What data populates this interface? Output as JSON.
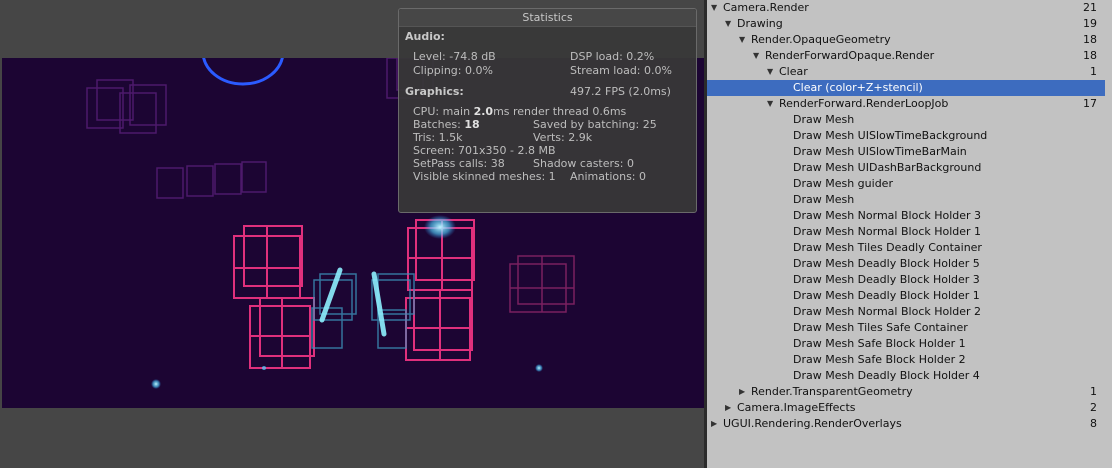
{
  "stats": {
    "title": "Statistics",
    "audio_header": "Audio:",
    "level": "Level: -74.8 dB",
    "dsp_load": "DSP load: 0.2%",
    "clipping": "Clipping: 0.0%",
    "stream_load": "Stream load: 0.0%",
    "graphics_header": "Graphics:",
    "fps": "497.2 FPS (2.0ms)",
    "cpu_prefix": "CPU: main ",
    "cpu_main": "2.0",
    "cpu_suffix": "ms  render thread 0.6ms",
    "batches_prefix": "Batches: ",
    "batches": "18",
    "saved_batching": "Saved by batching: 25",
    "tris": "Tris: 1.5k",
    "verts": "Verts: 2.9k",
    "screen": "Screen: 701x350 - 2.8 MB",
    "setpass": "SetPass calls: 38",
    "shadow_casters": "Shadow casters: 0",
    "skinned": "Visible skinned meshes: 1",
    "animations": "Animations: 0"
  },
  "tree": [
    {
      "label": "Camera.Render",
      "count": "21",
      "depth": 0,
      "arrow": "down"
    },
    {
      "label": "Drawing",
      "count": "19",
      "depth": 1,
      "arrow": "down"
    },
    {
      "label": "Render.OpaqueGeometry",
      "count": "18",
      "depth": 2,
      "arrow": "down"
    },
    {
      "label": "RenderForwardOpaque.Render",
      "count": "18",
      "depth": 3,
      "arrow": "down"
    },
    {
      "label": "Clear",
      "count": "1",
      "depth": 4,
      "arrow": "down"
    },
    {
      "label": "Clear (color+Z+stencil)",
      "count": "",
      "depth": 5,
      "arrow": "",
      "selected": true
    },
    {
      "label": "RenderForward.RenderLoopJob",
      "count": "17",
      "depth": 4,
      "arrow": "down"
    },
    {
      "label": "Draw Mesh",
      "count": "",
      "depth": 5,
      "arrow": ""
    },
    {
      "label": "Draw Mesh UISlowTimeBackground",
      "count": "",
      "depth": 5,
      "arrow": ""
    },
    {
      "label": "Draw Mesh UISlowTimeBarMain",
      "count": "",
      "depth": 5,
      "arrow": ""
    },
    {
      "label": "Draw Mesh UIDashBarBackground",
      "count": "",
      "depth": 5,
      "arrow": ""
    },
    {
      "label": "Draw Mesh guider",
      "count": "",
      "depth": 5,
      "arrow": ""
    },
    {
      "label": "Draw Mesh",
      "count": "",
      "depth": 5,
      "arrow": ""
    },
    {
      "label": "Draw Mesh Normal Block Holder 3",
      "count": "",
      "depth": 5,
      "arrow": ""
    },
    {
      "label": "Draw Mesh Normal Block Holder 1",
      "count": "",
      "depth": 5,
      "arrow": ""
    },
    {
      "label": "Draw Mesh Tiles Deadly Container",
      "count": "",
      "depth": 5,
      "arrow": ""
    },
    {
      "label": "Draw Mesh Deadly Block Holder 5",
      "count": "",
      "depth": 5,
      "arrow": ""
    },
    {
      "label": "Draw Mesh Deadly Block Holder 3",
      "count": "",
      "depth": 5,
      "arrow": ""
    },
    {
      "label": "Draw Mesh Deadly Block Holder 1",
      "count": "",
      "depth": 5,
      "arrow": ""
    },
    {
      "label": "Draw Mesh Normal Block Holder 2",
      "count": "",
      "depth": 5,
      "arrow": ""
    },
    {
      "label": "Draw Mesh Tiles Safe Container",
      "count": "",
      "depth": 5,
      "arrow": ""
    },
    {
      "label": "Draw Mesh Safe Block Holder 1",
      "count": "",
      "depth": 5,
      "arrow": ""
    },
    {
      "label": "Draw Mesh Safe Block Holder 2",
      "count": "",
      "depth": 5,
      "arrow": ""
    },
    {
      "label": "Draw Mesh Deadly Block Holder 4",
      "count": "",
      "depth": 5,
      "arrow": ""
    },
    {
      "label": "Render.TransparentGeometry",
      "count": "1",
      "depth": 2,
      "arrow": "right"
    },
    {
      "label": "Camera.ImageEffects",
      "count": "2",
      "depth": 1,
      "arrow": "right"
    },
    {
      "label": "UGUI.Rendering.RenderOverlays",
      "count": "8",
      "depth": 0,
      "arrow": "right"
    }
  ],
  "colors": {
    "scene_bg": "#1c0533",
    "neon_pink": "#e0307c",
    "neon_purple": "#8a2cae",
    "neon_cyan": "#5fd8ff",
    "selection": "#3d6cbf"
  },
  "icons": {
    "expanded": "triangle-down-icon",
    "collapsed": "triangle-right-icon"
  }
}
